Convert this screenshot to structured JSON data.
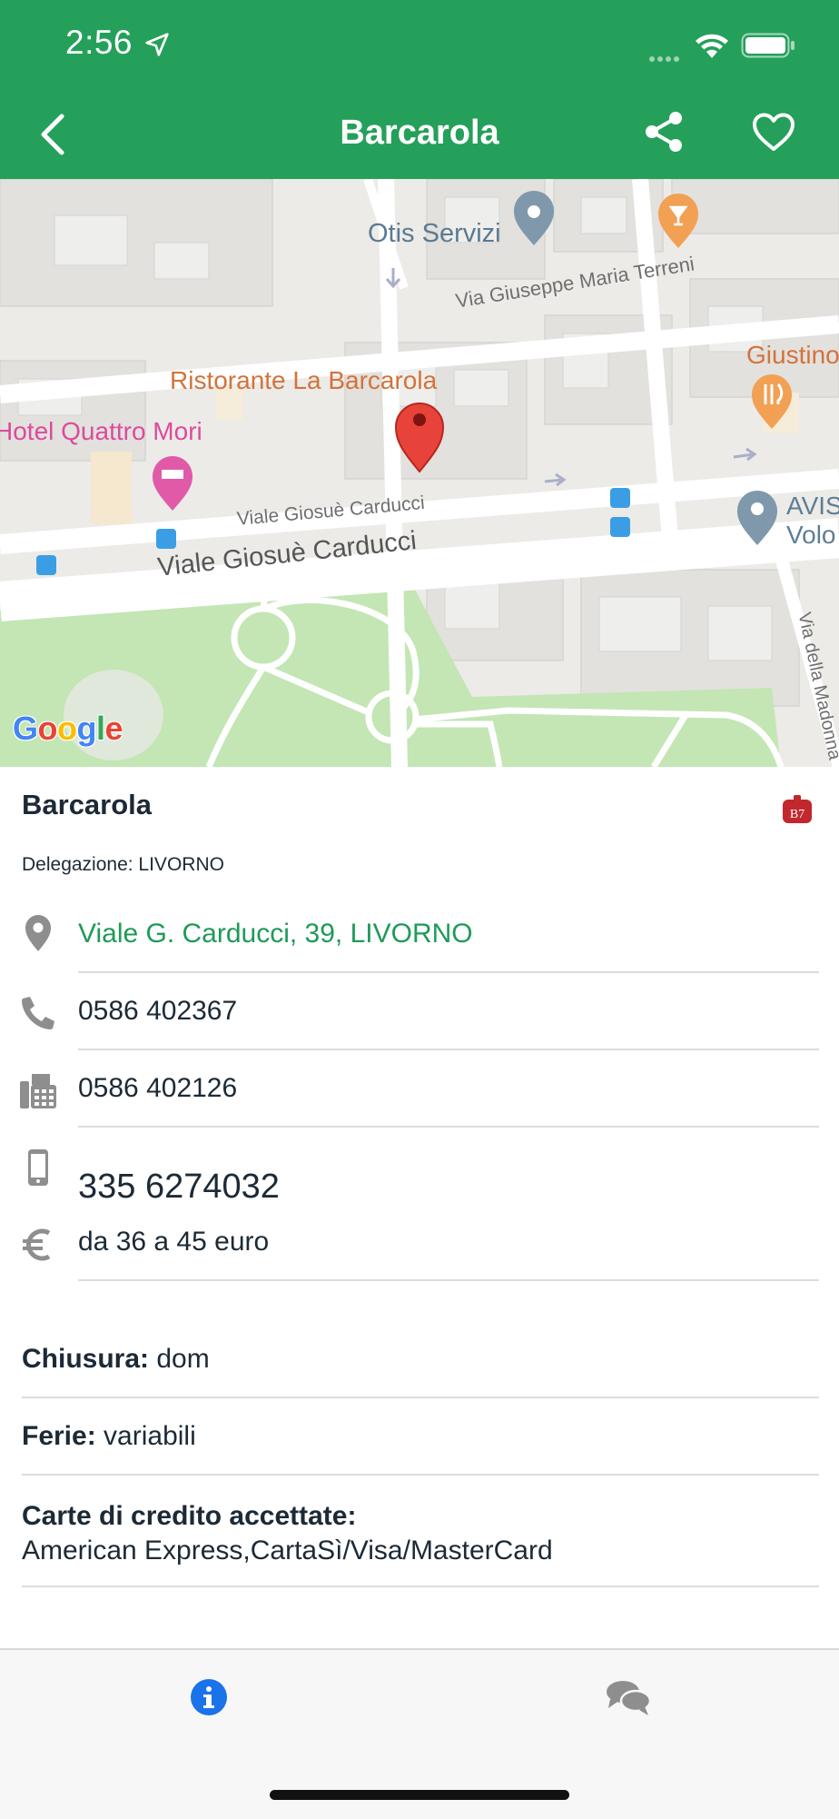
{
  "status_bar": {
    "time": "2:56"
  },
  "nav": {
    "title": "Barcarola"
  },
  "map": {
    "labels": {
      "otis": "Otis Servizi",
      "terreni": "Via Giuseppe Maria Terreni",
      "giustino": "Giustino",
      "ristorante": "Ristorante La Barcarola",
      "hotel": "Hotel Quattro Mori",
      "carducci_small": "Viale Giosuè Carducci",
      "carducci_big": "Viale Giosuè Carducci",
      "avis_line1": "AVIS",
      "avis_line2": "Volo",
      "della": "Via della Madonna"
    },
    "google_letters": [
      "G",
      "o",
      "o",
      "g",
      "l",
      "e"
    ],
    "google_colors": [
      "#4285f4",
      "#ea4335",
      "#fbbc05",
      "#4285f4",
      "#34a853",
      "#ea4335"
    ]
  },
  "place": {
    "name": "Barcarola",
    "delegation": "Delegazione: LIVORNO",
    "address": "Viale G. Carducci, 39, LIVORNO",
    "phone": "0586 402367",
    "fax": "0586 402126",
    "mobile": "335 6274032",
    "price": "da 36 a 45 euro"
  },
  "info": {
    "closing_label": "Chiusura:",
    "closing_value": "dom",
    "holidays_label": "Ferie:",
    "holidays_value": "variabili",
    "cards_label": "Carte di credito accettate:",
    "cards_value": "American Express,CartaSì/Visa/MasterCard"
  },
  "colors": {
    "primary_green": "#24a05a",
    "link_green": "#1f9a58",
    "tab_active": "#1a73e8",
    "tab_inactive": "#8e8e8e"
  },
  "icons": {
    "location": "map-pin-icon",
    "phone": "phone-icon",
    "fax": "fax-icon",
    "mobile": "mobile-icon",
    "price": "euro-icon",
    "tab_info": "info-icon",
    "tab_comments": "comments-icon"
  }
}
